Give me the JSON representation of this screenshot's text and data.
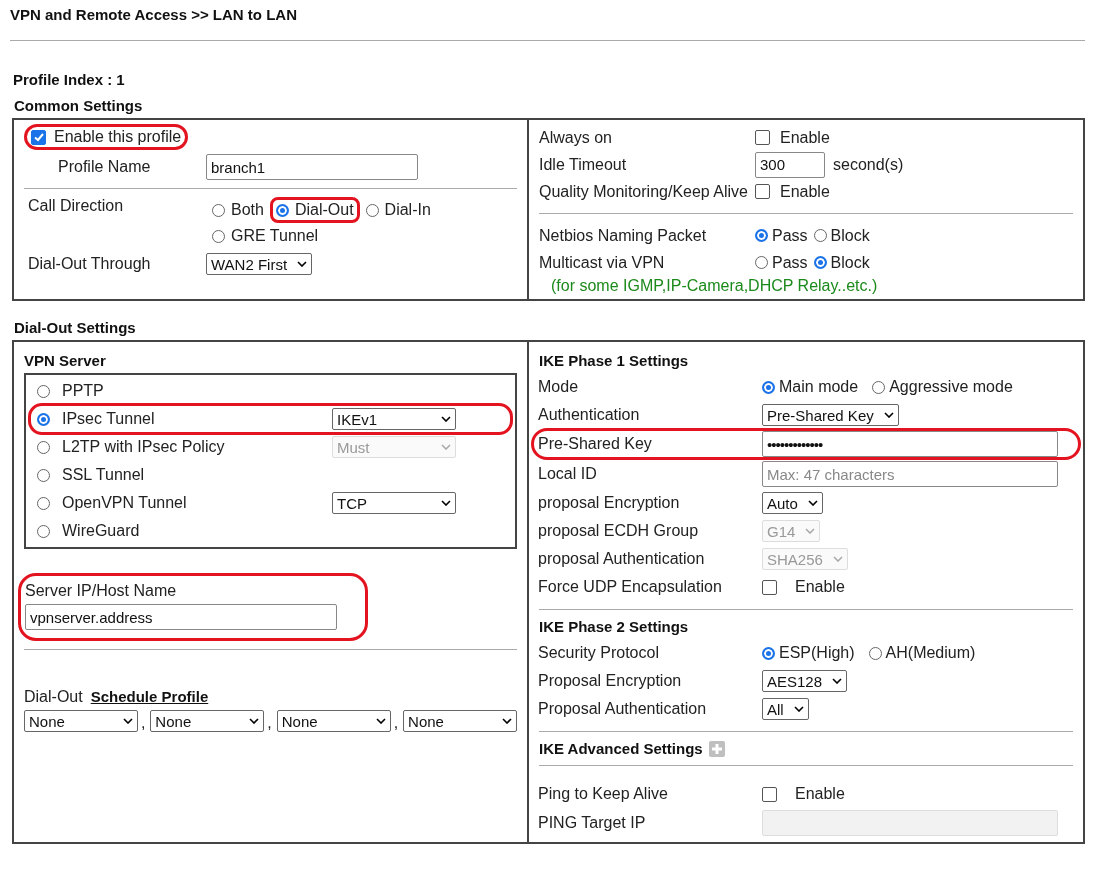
{
  "title": "VPN and Remote Access >> LAN to LAN",
  "profile_index": "Profile Index : 1",
  "common": {
    "heading": "Common Settings",
    "enable_profile": {
      "label": "Enable this profile",
      "checked": true,
      "highlighted": true
    },
    "profile_name": {
      "label": "Profile Name",
      "value": "branch1"
    },
    "call_direction": {
      "label": "Call Direction",
      "options": [
        {
          "label": "Both",
          "selected": false,
          "highlighted": false
        },
        {
          "label": "Dial-Out",
          "selected": true,
          "highlighted": true
        },
        {
          "label": "Dial-In",
          "selected": false,
          "highlighted": false
        },
        {
          "label": "GRE Tunnel",
          "selected": false,
          "highlighted": false
        }
      ]
    },
    "dial_out_through": {
      "label": "Dial-Out Through",
      "value": "WAN2 First"
    },
    "right_rows": [
      {
        "kind": "checkbox",
        "label": "Always on",
        "checkbox_label": "Enable",
        "checked": false
      },
      {
        "kind": "number",
        "label": "Idle Timeout",
        "value": "300",
        "unit": "second(s)"
      },
      {
        "kind": "checkbox",
        "label": "Quality Monitoring/Keep Alive",
        "checkbox_label": "Enable",
        "checked": false
      }
    ],
    "right_rows_2": [
      {
        "kind": "radio",
        "label": "Netbios Naming Packet",
        "options": [
          {
            "label": "Pass",
            "selected": true
          },
          {
            "label": "Block",
            "selected": false
          }
        ]
      },
      {
        "kind": "radio",
        "label": "Multicast via VPN",
        "options": [
          {
            "label": "Pass",
            "selected": false
          },
          {
            "label": "Block",
            "selected": true
          }
        ]
      }
    ],
    "note": "(for some IGMP,IP-Camera,DHCP Relay..etc.)"
  },
  "dial_out": {
    "heading": "Dial-Out Settings",
    "vpn_server": {
      "heading": "VPN Server",
      "options": [
        {
          "label": "PPTP",
          "selected": false,
          "highlighted": false
        },
        {
          "label": "IPsec Tunnel",
          "selected": true,
          "highlighted": true,
          "select": {
            "value": "IKEv1",
            "disabled": false
          }
        },
        {
          "label": "L2TP with IPsec Policy",
          "selected": false,
          "highlighted": false,
          "select": {
            "value": "Must",
            "disabled": true
          }
        },
        {
          "label": "SSL Tunnel",
          "selected": false,
          "highlighted": false
        },
        {
          "label": "OpenVPN Tunnel",
          "selected": false,
          "highlighted": false,
          "select": {
            "value": "TCP",
            "disabled": false
          }
        },
        {
          "label": "WireGuard",
          "selected": false,
          "highlighted": false
        }
      ]
    },
    "server_host": {
      "label": "Server IP/Host Name",
      "value": "vpnserver.address",
      "highlighted": true
    },
    "schedule": {
      "label": "Dial-Out",
      "link": "Schedule Profile",
      "selects": [
        "None",
        "None",
        "None",
        "None"
      ],
      "separators": [
        ",",
        ",",
        ","
      ]
    },
    "sections": [
      {
        "heading": "IKE Phase 1 Settings",
        "rows": [
          {
            "kind": "radio",
            "label": "Mode",
            "options": [
              {
                "label": "Main mode",
                "selected": true
              },
              {
                "label": "Aggressive mode",
                "selected": false
              }
            ]
          },
          {
            "kind": "select",
            "label": "Authentication",
            "value": "Pre-Shared Key",
            "disabled": false
          },
          {
            "kind": "password",
            "label": "Pre-Shared Key",
            "value": "•••••••••••••",
            "highlighted": true
          },
          {
            "kind": "input",
            "label": "Local ID",
            "placeholder": "Max: 47 characters"
          },
          {
            "kind": "select",
            "label": "proposal Encryption",
            "value": "Auto",
            "disabled": false
          },
          {
            "kind": "select",
            "label": "proposal ECDH Group",
            "value": "G14",
            "disabled": true
          },
          {
            "kind": "select",
            "label": "proposal Authentication",
            "value": "SHA256",
            "disabled": true
          },
          {
            "kind": "checkbox",
            "label": "Force UDP Encapsulation",
            "checkbox_label": "Enable",
            "checked": false
          }
        ]
      },
      {
        "heading": "IKE Phase 2 Settings",
        "rows": [
          {
            "kind": "radio",
            "label": "Security Protocol",
            "options": [
              {
                "label": "ESP(High)",
                "selected": true
              },
              {
                "label": "AH(Medium)",
                "selected": false
              }
            ]
          },
          {
            "kind": "select",
            "label": "Proposal Encryption",
            "value": "AES128",
            "disabled": false
          },
          {
            "kind": "select",
            "label": "Proposal Authentication",
            "value": "All",
            "disabled": false
          }
        ]
      },
      {
        "heading": "IKE Advanced Settings",
        "expandable": true
      },
      {
        "rows": [
          {
            "kind": "checkbox",
            "label": "Ping to Keep Alive",
            "checkbox_label": "Enable",
            "checked": false
          },
          {
            "kind": "input",
            "label": "PING Target IP",
            "disabled": true
          }
        ]
      }
    ]
  }
}
